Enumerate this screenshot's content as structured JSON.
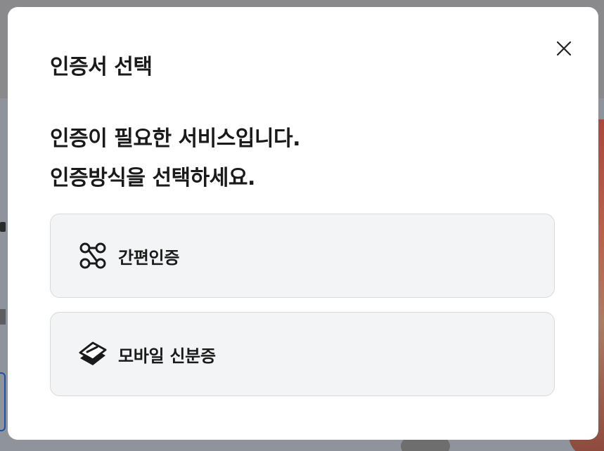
{
  "modal": {
    "title": "인증서 선택",
    "close_icon": "close-icon",
    "headline_line1": "인증이 필요한 서비스입니다.",
    "headline_line2": "인증방식을 선택하세요."
  },
  "options": [
    {
      "label": "간편인증",
      "icon": "simple-auth-icon"
    },
    {
      "label": "모바일 신분증",
      "icon": "mobile-id-icon"
    }
  ],
  "colors": {
    "overlay": "#8e8e90",
    "modal_bg": "#ffffff",
    "option_bg": "#f3f4f6",
    "option_border": "#d9d9dc",
    "text": "#1a1a1a"
  }
}
